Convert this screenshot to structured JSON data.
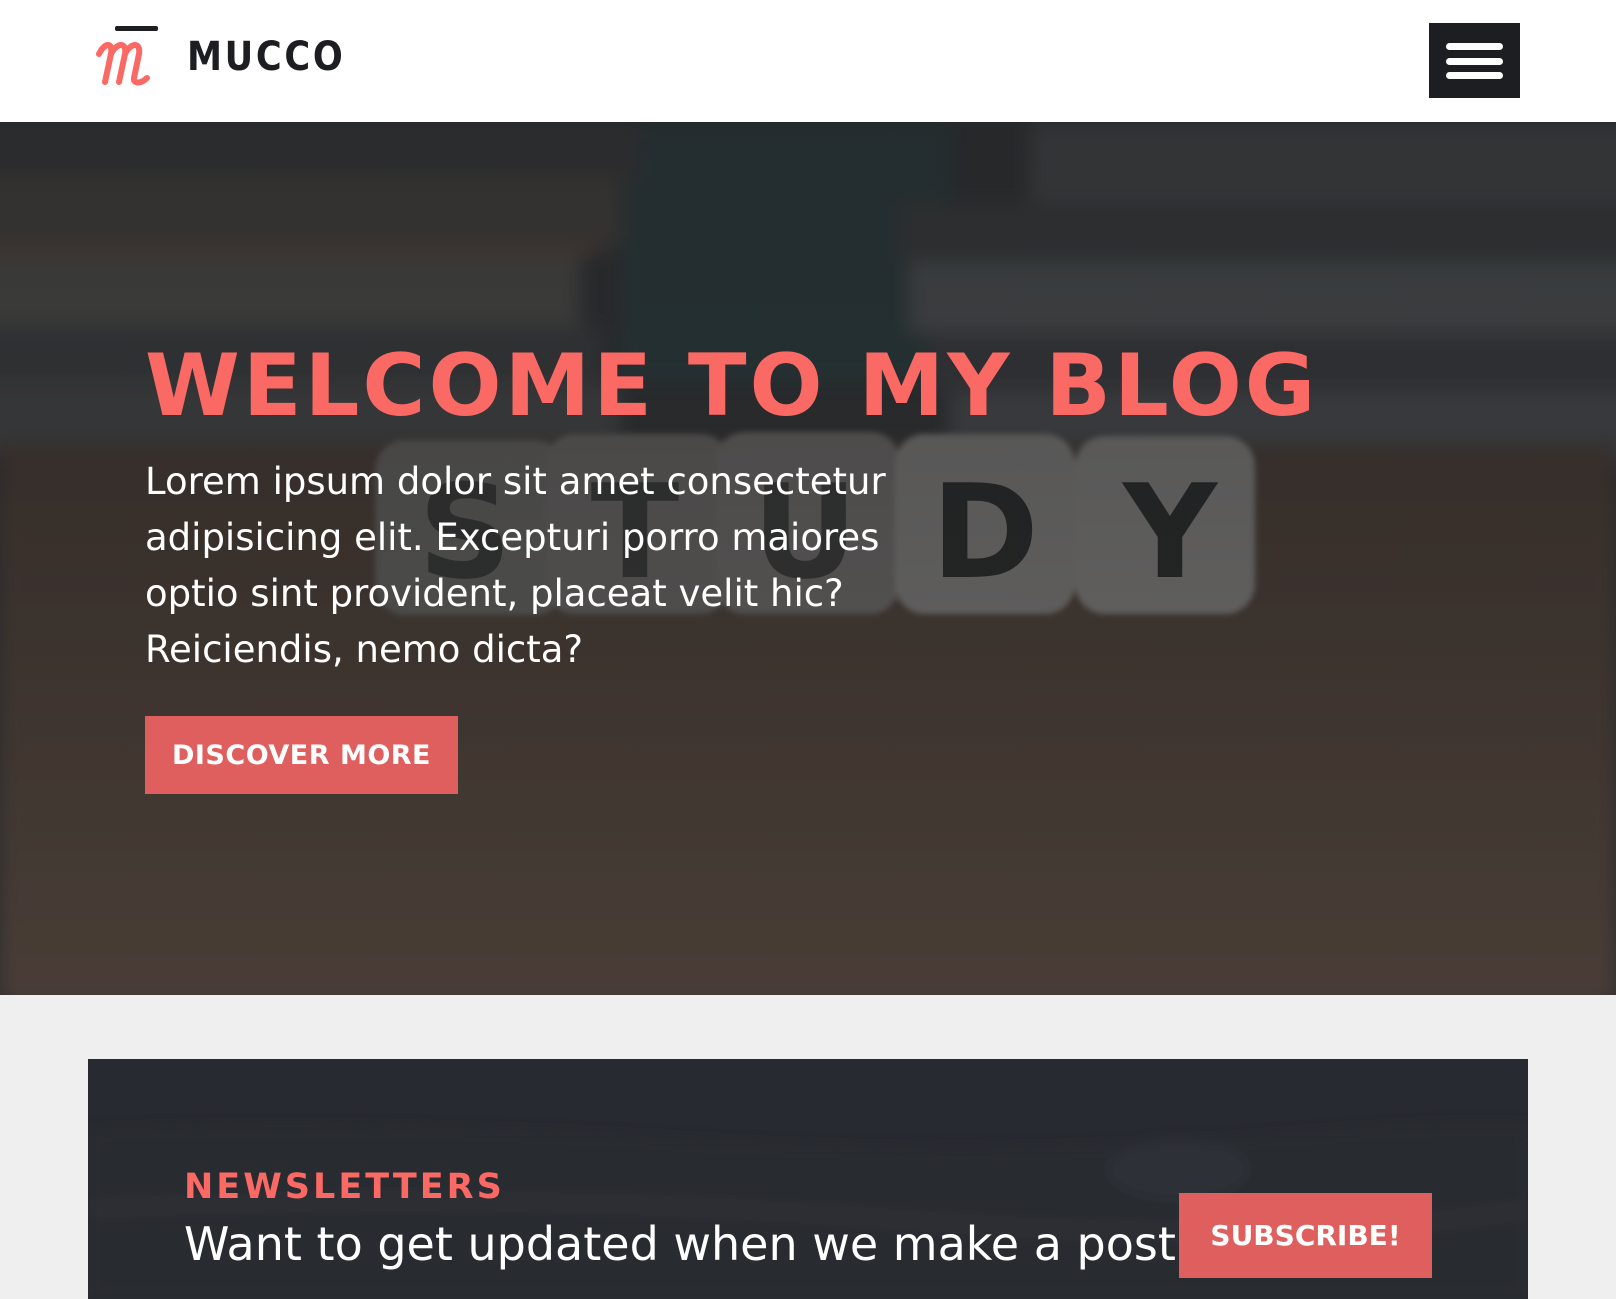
{
  "header": {
    "brand_name": "MUCCO",
    "logo_icon": "m-script-logo-icon",
    "menu_icon": "hamburger-menu-icon"
  },
  "hero": {
    "background": "blurred photo of books and wooden dice spelling STUDY on a desk",
    "title": "WELCOME TO MY BLOG",
    "text": "Lorem ipsum dolor sit amet consectetur adipisicing elit. Excepturi porro maiores optio sint provident, placeat velit hic? Reiciendis, nemo dicta?",
    "cta_label": "DISCOVER MORE",
    "dice_letters": [
      "S",
      "T",
      "U",
      "D",
      "Y"
    ]
  },
  "newsletter": {
    "label": "NEWSLETTERS",
    "text": "Want to get updated when we make a post?",
    "button_label": "SUBSCRIBE!"
  },
  "colors": {
    "accent": "#fb6964",
    "button": "#de5f5d",
    "dark": "#1d1e22",
    "page_bg": "#efefef"
  }
}
